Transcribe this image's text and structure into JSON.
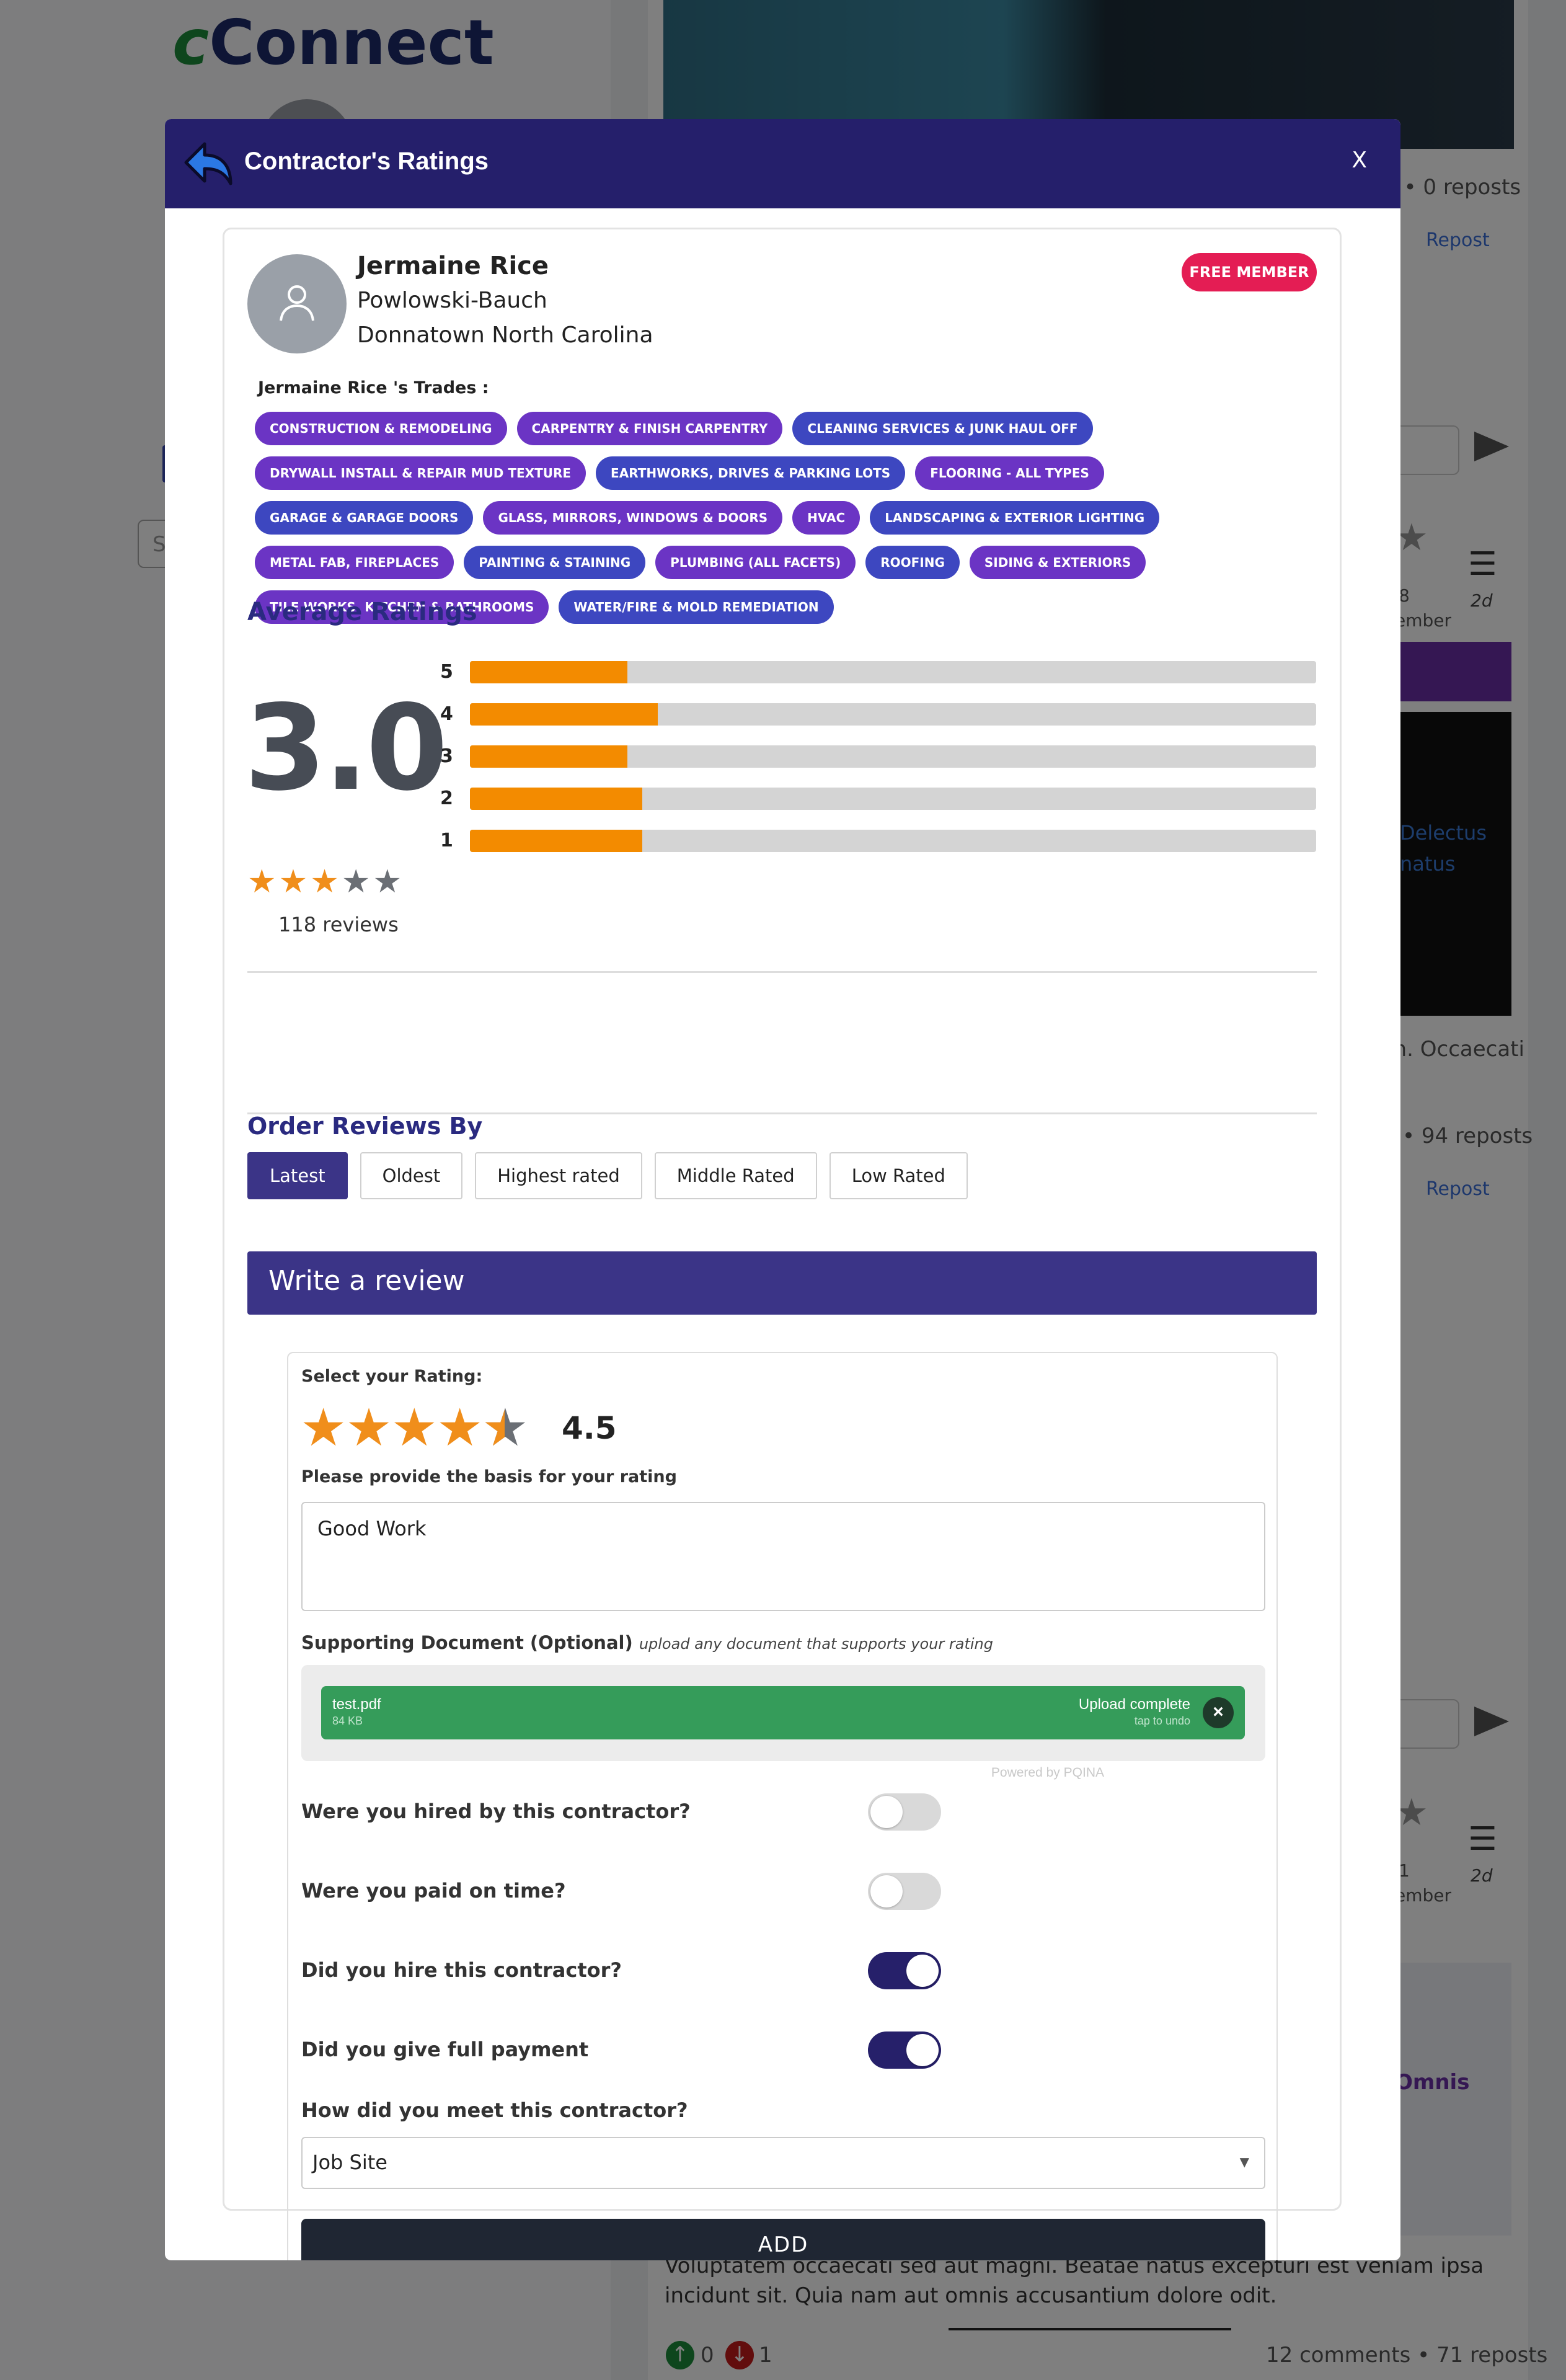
{
  "background": {
    "logo_c": "c",
    "logo_rest": "Connect",
    "left_input_placeholder": "S",
    "reposts_1": "s • 0 reposts",
    "repost_label": "Repost",
    "star_frag_1": "8",
    "member_frag": "ember",
    "time_1": "2d",
    "dark_text_1": "Delectus",
    "dark_text_2": "natus",
    "occaecati": "m. Occaecati",
    "reposts_2": "• 94 reposts",
    "star_frag_2": "1",
    "time_2": "2d",
    "omnis": "Omnis",
    "paragraph": "Voluptatem occaecati sed aut magni. Beatae natus excepturi est veniam ipsa incidunt sit. Quia nam aut omnis accusantium dolore odit.",
    "upvotes": "0",
    "downvotes": "1",
    "comments_reposts": "12 comments • 71 reposts"
  },
  "modal": {
    "title": "Contractor's Ratings",
    "close_label": "X"
  },
  "contractor": {
    "name": "Jermaine Rice",
    "company": "Powlowski-Bauch",
    "location": "Donnatown North Carolina",
    "badge": "FREE MEMBER",
    "trades_title": "Jermaine Rice 's Trades :",
    "trades": [
      {
        "label": "CONSTRUCTION & REMODELING",
        "color": "purple"
      },
      {
        "label": "CARPENTRY & FINISH CARPENTRY",
        "color": "purple"
      },
      {
        "label": "CLEANING SERVICES & JUNK HAUL OFF",
        "color": "blue"
      },
      {
        "label": "DRYWALL INSTALL & REPAIR MUD TEXTURE",
        "color": "purple"
      },
      {
        "label": "EARTHWORKS, DRIVES & PARKING LOTS",
        "color": "blue"
      },
      {
        "label": "FLOORING - ALL TYPES",
        "color": "purple"
      },
      {
        "label": "GARAGE & GARAGE DOORS",
        "color": "blue"
      },
      {
        "label": "GLASS, MIRRORS, WINDOWS & DOORS",
        "color": "purple"
      },
      {
        "label": "HVAC",
        "color": "purple"
      },
      {
        "label": "LANDSCAPING & EXTERIOR LIGHTING",
        "color": "blue"
      },
      {
        "label": "METAL FAB, FIREPLACES",
        "color": "purple"
      },
      {
        "label": "PAINTING & STAINING",
        "color": "blue"
      },
      {
        "label": "PLUMBING (ALL FACETS)",
        "color": "purple"
      },
      {
        "label": "ROOFING",
        "color": "blue"
      },
      {
        "label": "SIDING & EXTERIORS",
        "color": "purple"
      },
      {
        "label": "TILE WORKS, KITCHEN & BATHROOMS",
        "color": "purple"
      },
      {
        "label": "WATER/FIRE & MOLD REMEDIATION",
        "color": "blue"
      }
    ]
  },
  "ratings": {
    "title": "Average Ratings",
    "average": "3.0",
    "stars_filled": 3,
    "stars_total": 5,
    "reviews_count": "118 reviews",
    "distribution": [
      {
        "label": "5",
        "fraction": 0.186
      },
      {
        "label": "4",
        "fraction": 0.222
      },
      {
        "label": "3",
        "fraction": 0.186
      },
      {
        "label": "2",
        "fraction": 0.204
      },
      {
        "label": "1",
        "fraction": 0.204
      }
    ]
  },
  "order": {
    "title": "Order Reviews By",
    "options": [
      "Latest",
      "Oldest",
      "Highest rated",
      "Middle Rated",
      "Low Rated"
    ],
    "active": "Latest"
  },
  "review_form": {
    "header": "Write a review",
    "rating_label": "Select your Rating:",
    "rating_value": "4.5",
    "basis_label": "Please provide the basis for your rating",
    "basis_text": "Good Work",
    "support_label": "Supporting Document (Optional)",
    "support_hint": "upload any document that supports your rating",
    "file": {
      "name": "test.pdf",
      "size": "84 KB",
      "status": "Upload complete",
      "undo": "tap to undo"
    },
    "powered_by": "Powered by PQINA",
    "questions": [
      {
        "label": "Were you hired by this contractor?",
        "on": false
      },
      {
        "label": "Were you paid on time?",
        "on": false
      },
      {
        "label": "Did you hire this contractor?",
        "on": true
      },
      {
        "label": "Did you give full payment",
        "on": true
      }
    ],
    "meet_label": "How did you meet this contractor?",
    "meet_value": "Job Site",
    "add_label": "ADD"
  }
}
